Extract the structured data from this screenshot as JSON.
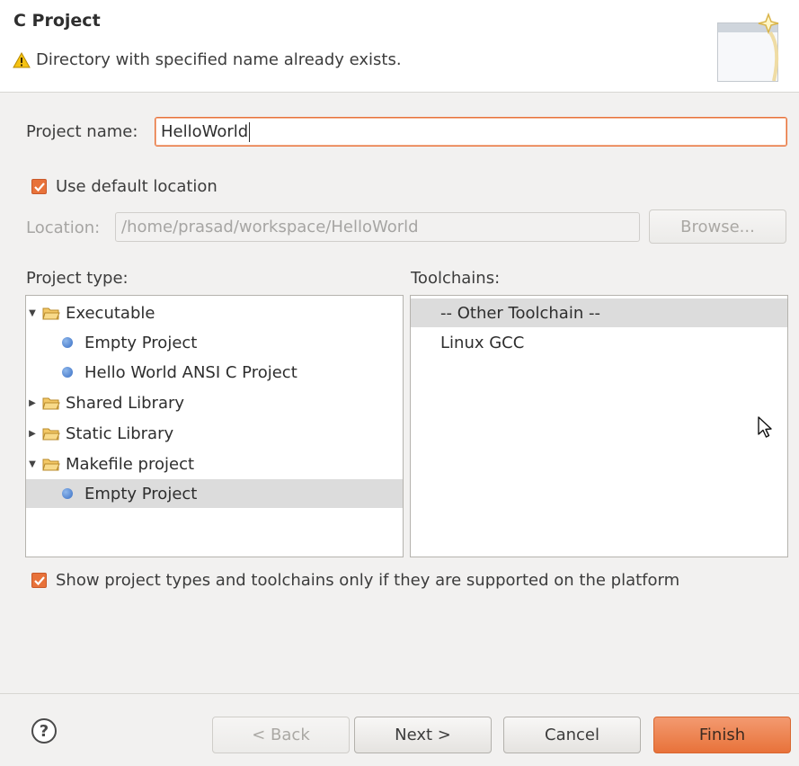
{
  "header": {
    "title": "C Project",
    "message": "Directory with specified name already exists."
  },
  "project_name": {
    "label": "Project name:",
    "value": "HelloWorld"
  },
  "use_default_location": {
    "label": "Use default location",
    "checked": true
  },
  "location": {
    "label": "Location:",
    "value": "/home/prasad/workspace/HelloWorld",
    "browse_label": "Browse..."
  },
  "project_type": {
    "label": "Project type:",
    "items": [
      {
        "label": "Executable",
        "kind": "folder",
        "expanded": true
      },
      {
        "label": "Empty Project",
        "kind": "leaf"
      },
      {
        "label": "Hello World ANSI C Project",
        "kind": "leaf"
      },
      {
        "label": "Shared Library",
        "kind": "folder",
        "expanded": false
      },
      {
        "label": "Static Library",
        "kind": "folder",
        "expanded": false
      },
      {
        "label": "Makefile project",
        "kind": "folder",
        "expanded": true
      },
      {
        "label": "Empty Project",
        "kind": "leaf",
        "selected": true
      }
    ]
  },
  "toolchains": {
    "label": "Toolchains:",
    "items": [
      {
        "label": "-- Other Toolchain --",
        "selected": true
      },
      {
        "label": "Linux GCC"
      }
    ]
  },
  "show_supported": {
    "label": "Show project types and toolchains only if they are supported on the platform",
    "checked": true
  },
  "buttons": {
    "help": "?",
    "back": "< Back",
    "next": "Next >",
    "cancel": "Cancel",
    "finish": "Finish"
  },
  "colors": {
    "accent": "#e8723a",
    "selection": "#dcdcdc",
    "background": "#f2f1f0"
  }
}
